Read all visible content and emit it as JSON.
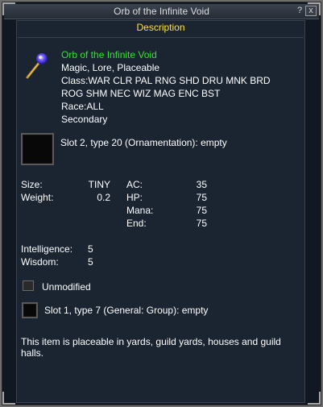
{
  "window": {
    "title": "Orb of the Infinite Void",
    "help_label": "?",
    "close_label": "x"
  },
  "panel": {
    "header": "Description"
  },
  "item": {
    "name": "Orb of the Infinite Void",
    "flags": "Magic, Lore, Placeable",
    "class_line1": "Class:WAR CLR PAL RNG SHD DRU MNK BRD",
    "class_line2": "ROG SHM NEC WIZ MAG ENC BST",
    "race": "Race:ALL",
    "slot": "Secondary",
    "ornament_slot": "Slot 2, type 20 (Ornamentation): empty"
  },
  "stats": {
    "size_label": "Size:",
    "size_value": "TINY",
    "weight_label": "Weight:",
    "weight_value": "0.2",
    "ac_label": "AC:",
    "ac_value": "35",
    "hp_label": "HP:",
    "hp_value": "75",
    "mana_label": "Mana:",
    "mana_value": "75",
    "end_label": "End:",
    "end_value": "75",
    "int_label": "Intelligence:",
    "int_value": "5",
    "wis_label": "Wisdom:",
    "wis_value": "5"
  },
  "augment": {
    "unmodified_label": "Unmodified",
    "general_slot": "Slot 1, type 7 (General: Group): empty"
  },
  "footer": {
    "note_line1": "This item is placeable in yards, guild yards, houses and guild",
    "note_line2": "halls."
  },
  "colors": {
    "item_name": "#2fe62f",
    "header": "#ffe23c",
    "panel_bg": "#1b2431"
  },
  "icons": {
    "item": "orb-staff-icon",
    "close": "close-icon",
    "help": "help-icon"
  }
}
